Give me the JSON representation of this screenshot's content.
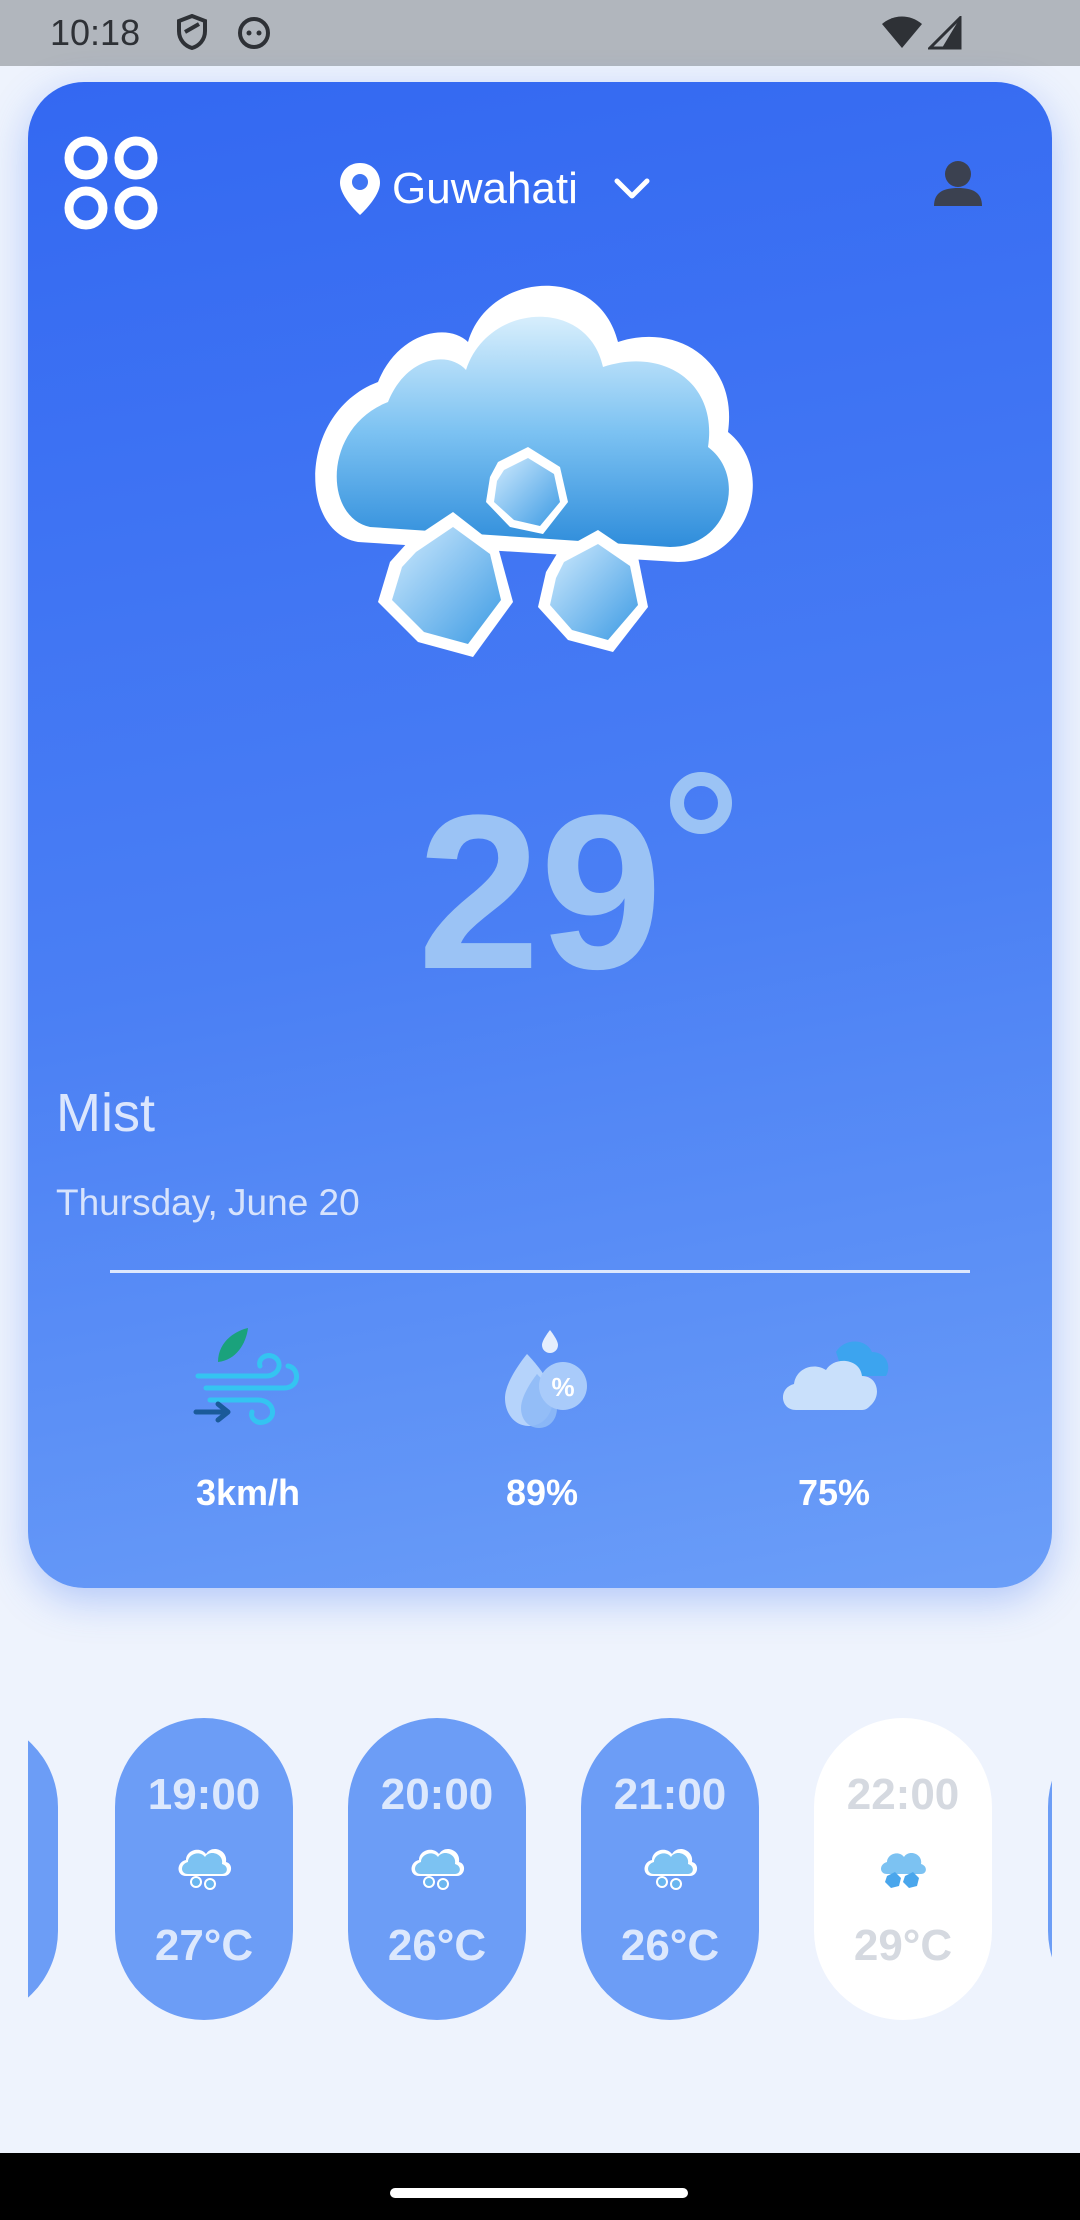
{
  "status_bar": {
    "time": "10:18"
  },
  "header": {
    "location": "Guwahati"
  },
  "current": {
    "temperature": "29",
    "condition": "Mist",
    "date": "Thursday, June 20"
  },
  "stats": [
    {
      "icon": "wind-icon",
      "value": "3km/h"
    },
    {
      "icon": "humidity-icon",
      "value": "89%"
    },
    {
      "icon": "cloud-icon",
      "value": "75%"
    }
  ],
  "hourly": [
    {
      "time": "19:00",
      "temp": "27°C"
    },
    {
      "time": "20:00",
      "temp": "26°C"
    },
    {
      "time": "21:00",
      "temp": "26°C"
    },
    {
      "time": "22:00",
      "temp": "29°C"
    }
  ],
  "colors": {
    "card_start": "#3368f2",
    "card_end": "#6b9ef8",
    "pill": "#6c9df6",
    "background": "#eef3fd"
  }
}
